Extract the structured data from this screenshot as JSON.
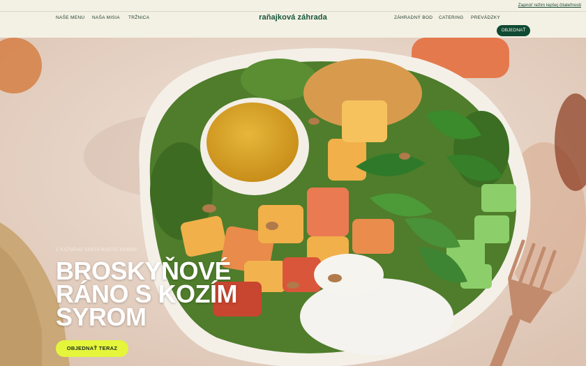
{
  "accessibility_link": "Zapnúť režim lepšej čitateľnosti",
  "nav": {
    "left_items": [
      {
        "label": "NAŠE MENU"
      },
      {
        "label": "NAŠA MISIA"
      },
      {
        "label": "TRŽNICA"
      }
    ],
    "logo": "raňajková záhrada",
    "right_items": [
      {
        "label": "ZÁHRADNÝ BOD"
      },
      {
        "label": "CATERING"
      },
      {
        "label": "PREVÁDZKY"
      }
    ],
    "order_button": "OBJEDNAŤ"
  },
  "hero": {
    "kicker": "Z KAŽDÉHO SÚSTA RASTIE DOBRO",
    "title": "BROSKYŇOVÉ RÁNO S KOZÍM SYROM",
    "cta": "OBJEDNAŤ TERAZ",
    "image_description": "salad-bowl-photo"
  },
  "colors": {
    "brand_green": "#17553a",
    "nav_bg": "#f3f1e4",
    "cta_yellow": "#e4f53b"
  }
}
